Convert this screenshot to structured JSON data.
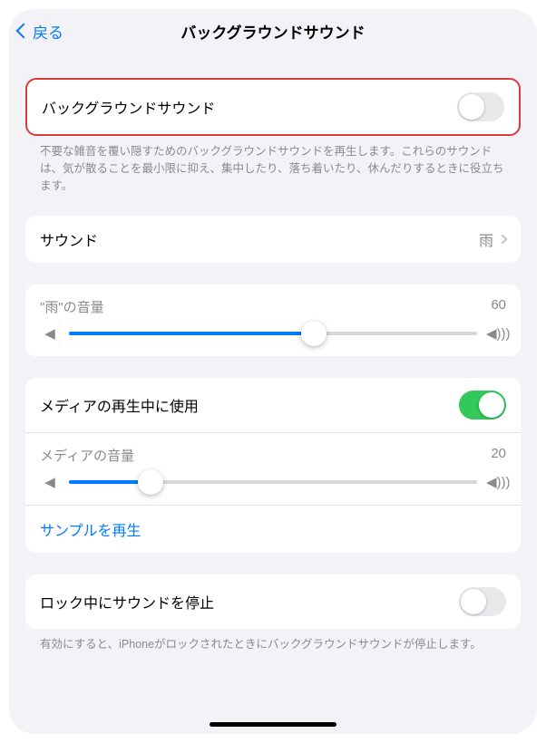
{
  "nav": {
    "back_label": "戻る",
    "title": "バックグラウンドサウンド"
  },
  "main_toggle": {
    "label": "バックグラウンドサウンド",
    "on": false,
    "footer": "不要な雑音を覆い隠すためのバックグラウンドサウンドを再生します。これらのサウンドは、気が散ることを最小限に抑え、集中したり、落ち着いたり、休んだりするときに役立ちます。"
  },
  "sound_select": {
    "label": "サウンド",
    "value": "雨"
  },
  "volume": {
    "label": "\"雨\"の音量",
    "value": 60
  },
  "media": {
    "use_label": "メディアの再生中に使用",
    "use_on": true,
    "vol_label": "メディアの音量",
    "vol_value": 20,
    "sample_link": "サンプルを再生"
  },
  "lock": {
    "label": "ロック中にサウンドを停止",
    "on": false,
    "footer": "有効にすると、iPhoneがロックされたときにバックグラウンドサウンドが停止します。"
  }
}
